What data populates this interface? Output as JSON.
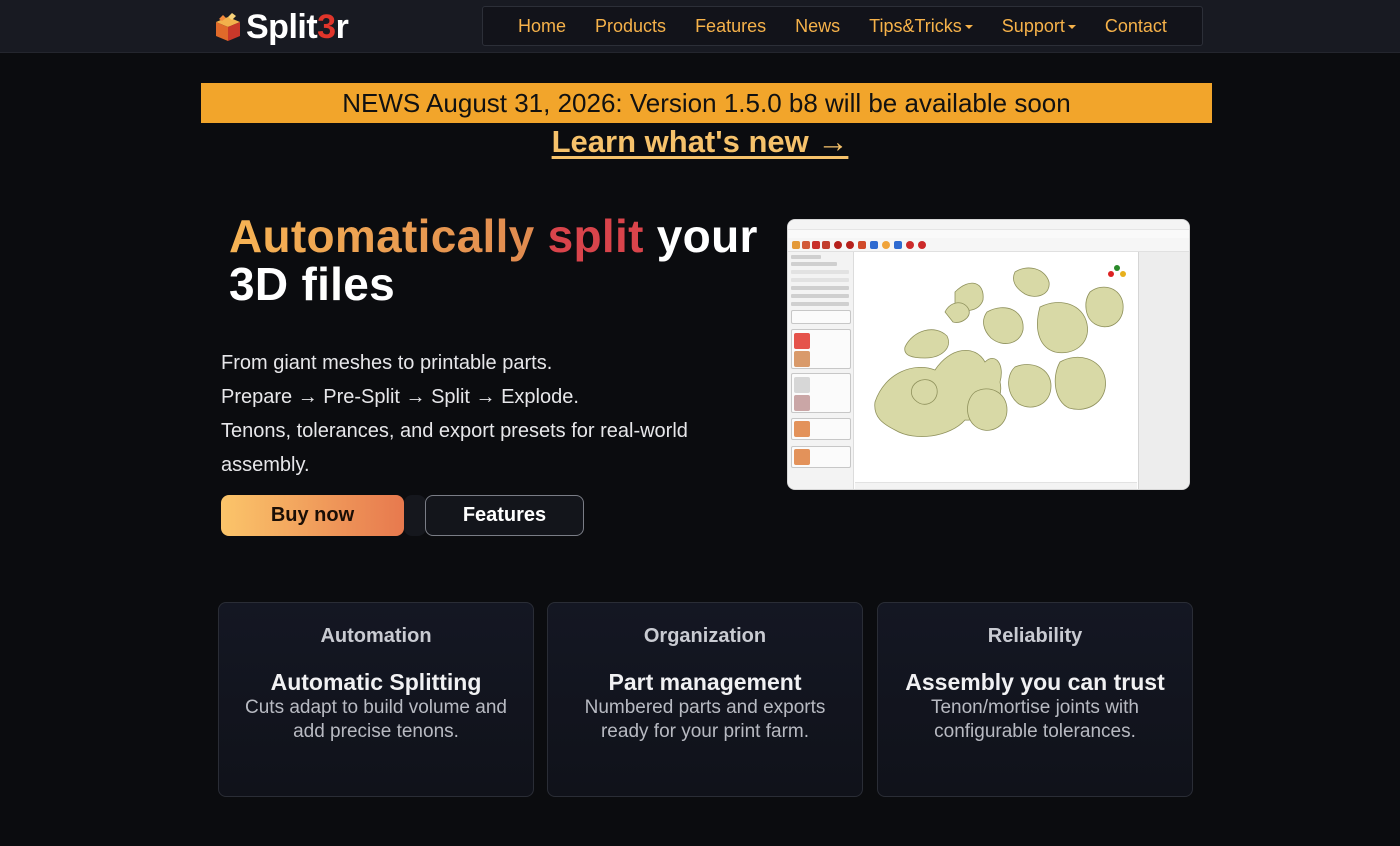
{
  "nav": {
    "logo_text_a": "Split",
    "logo_text_b": "3",
    "logo_text_c": "r",
    "items": [
      {
        "label": "Home",
        "dropdown": false
      },
      {
        "label": "Products",
        "dropdown": false
      },
      {
        "label": "Features",
        "dropdown": false
      },
      {
        "label": "News",
        "dropdown": false
      },
      {
        "label": "Tips&Tricks",
        "dropdown": true
      },
      {
        "label": "Support",
        "dropdown": true
      },
      {
        "label": "Contact",
        "dropdown": false
      }
    ]
  },
  "news": {
    "banner": "NEWS August 31, 2026: Version 1.5.0 b8 will be available soon",
    "link": "Learn what's new →"
  },
  "hero": {
    "title_part1": "Automatically",
    "title_part2": "split",
    "title_part3": "your",
    "title_line2": "3D files",
    "lead_1": "From giant meshes to printable parts.",
    "lead_2": "Prepare → Pre-Split → Split → Explode.",
    "lead_3": "Tenons, tolerances, and export presets for real-world assembly.",
    "buy_label": "Buy now",
    "features_label": "Features"
  },
  "cards": [
    {
      "category": "Automation",
      "title": "Automatic Splitting",
      "desc": "Cuts adapt to build volume and add precise tenons."
    },
    {
      "category": "Organization",
      "title": "Part management",
      "desc": "Numbered parts and exports ready for your print farm."
    },
    {
      "category": "Reliability",
      "title": "Assembly you can trust",
      "desc": "Tenon/mortise joints with configurable tolerances."
    }
  ],
  "colors": {
    "accent": "#f6b24a",
    "news_bg": "#f2a52b",
    "brand_red": "#e0352b",
    "page_bg": "#0b0c0f"
  }
}
